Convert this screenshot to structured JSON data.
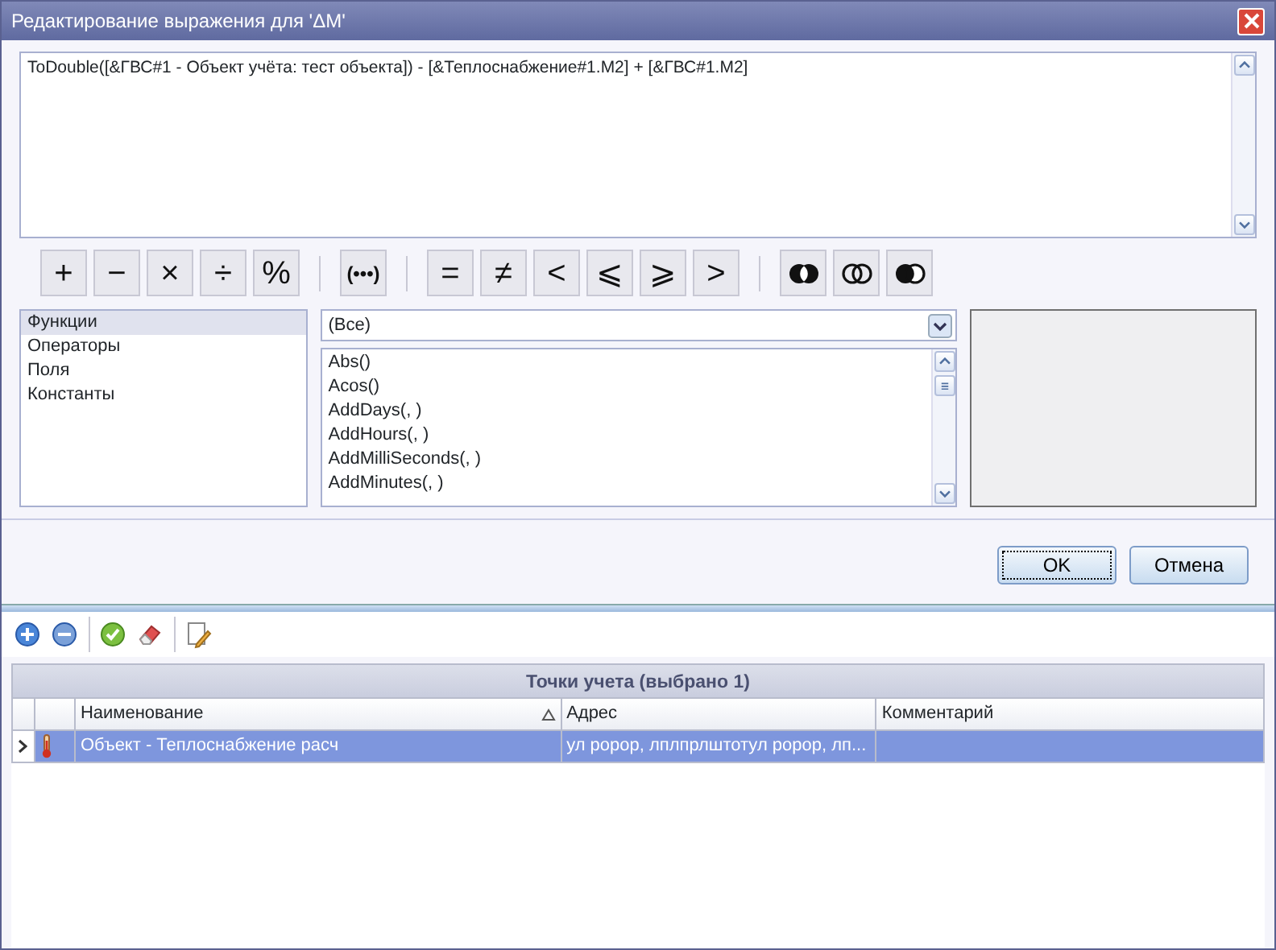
{
  "window": {
    "title": "Редактирование выражения для 'ΔM'"
  },
  "expression": {
    "value": "ToDouble([&ГВС#1 - Объект учёта: тест объекта]) - [&Теплоснабжение#1.M2] + [&ГВС#1.M2]"
  },
  "operator_groups": [
    {
      "items": [
        {
          "kind": "text",
          "label": "+"
        },
        {
          "kind": "text",
          "label": "−"
        },
        {
          "kind": "text",
          "label": "×"
        },
        {
          "kind": "text",
          "label": "÷"
        },
        {
          "kind": "text",
          "label": "%"
        }
      ]
    },
    {
      "items": [
        {
          "kind": "text",
          "label": "(•••)"
        }
      ]
    },
    {
      "items": [
        {
          "kind": "text",
          "label": "="
        },
        {
          "kind": "text",
          "label": "≠"
        },
        {
          "kind": "text",
          "label": "<"
        },
        {
          "kind": "text",
          "label": "⩽"
        },
        {
          "kind": "text",
          "label": "⩾"
        },
        {
          "kind": "text",
          "label": ">"
        }
      ]
    },
    {
      "items": [
        {
          "kind": "and"
        },
        {
          "kind": "or"
        },
        {
          "kind": "not"
        }
      ]
    }
  ],
  "categories": [
    {
      "label": "Функции",
      "selected": true
    },
    {
      "label": "Операторы",
      "selected": false
    },
    {
      "label": "Поля",
      "selected": false
    },
    {
      "label": "Константы",
      "selected": false
    }
  ],
  "filter": {
    "value": "(Все)"
  },
  "functions": [
    "Abs()",
    "Acos()",
    "AddDays(, )",
    "AddHours(, )",
    "AddMilliSeconds(, )",
    "AddMinutes(, )"
  ],
  "buttons": [
    {
      "label": "OK",
      "default": true
    },
    {
      "label": "Отмена",
      "default": false
    }
  ],
  "toolbar": [
    {
      "kind": "add"
    },
    {
      "kind": "remove"
    },
    {
      "kind": "sep"
    },
    {
      "kind": "check"
    },
    {
      "kind": "erase"
    },
    {
      "kind": "sep"
    },
    {
      "kind": "edit"
    }
  ],
  "table": {
    "caption": "Точки учета (выбрано 1)",
    "columns": [
      {
        "label": "Наименование",
        "sorted": true
      },
      {
        "label": "Адрес",
        "sorted": false
      },
      {
        "label": "Комментарий",
        "sorted": false
      }
    ],
    "rows": [
      {
        "selected": true,
        "cells": [
          "Объект - Теплоснабжение расч",
          "ул ророр, лплпрлштотул ророр, лп..."
        ]
      }
    ]
  }
}
